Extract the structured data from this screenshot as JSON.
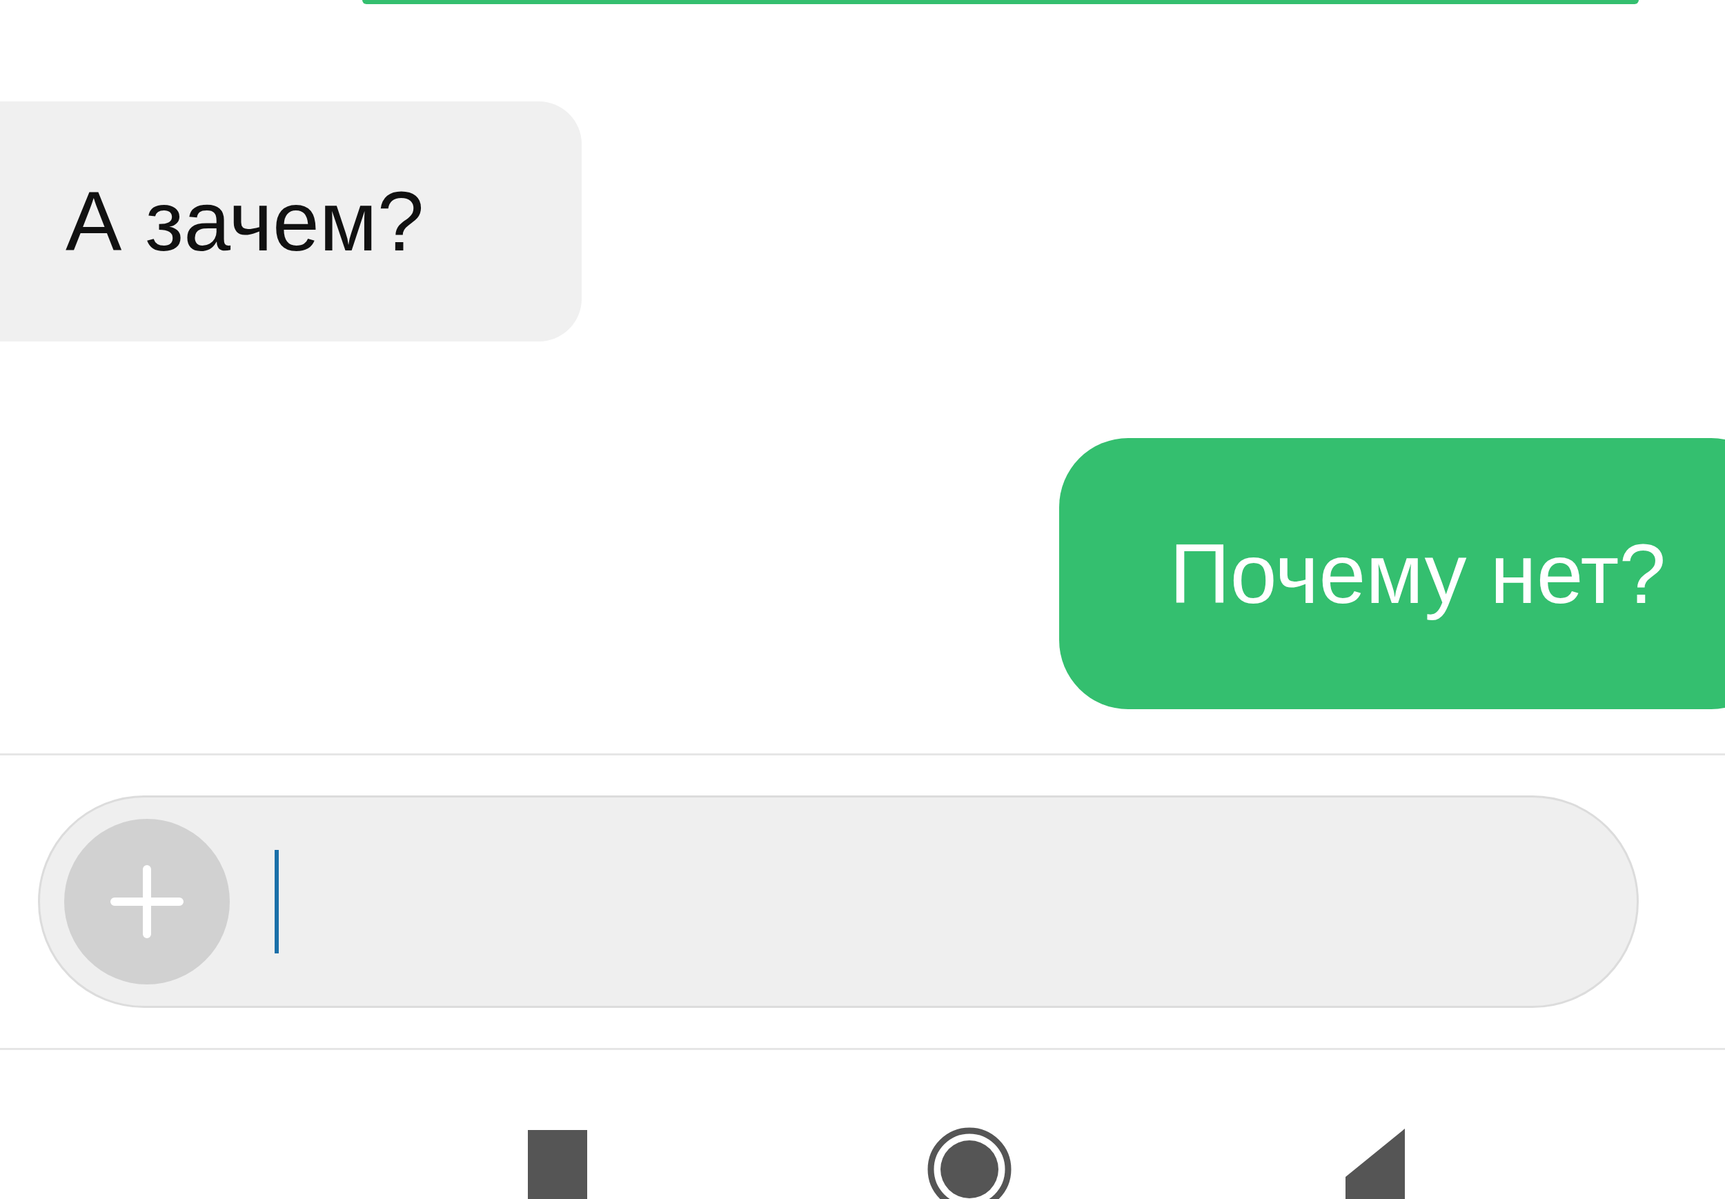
{
  "messages": [
    {
      "kind": "received",
      "text": "А зачем?"
    },
    {
      "kind": "sent",
      "text": "Почему нет?"
    }
  ],
  "composer": {
    "focused": true
  }
}
